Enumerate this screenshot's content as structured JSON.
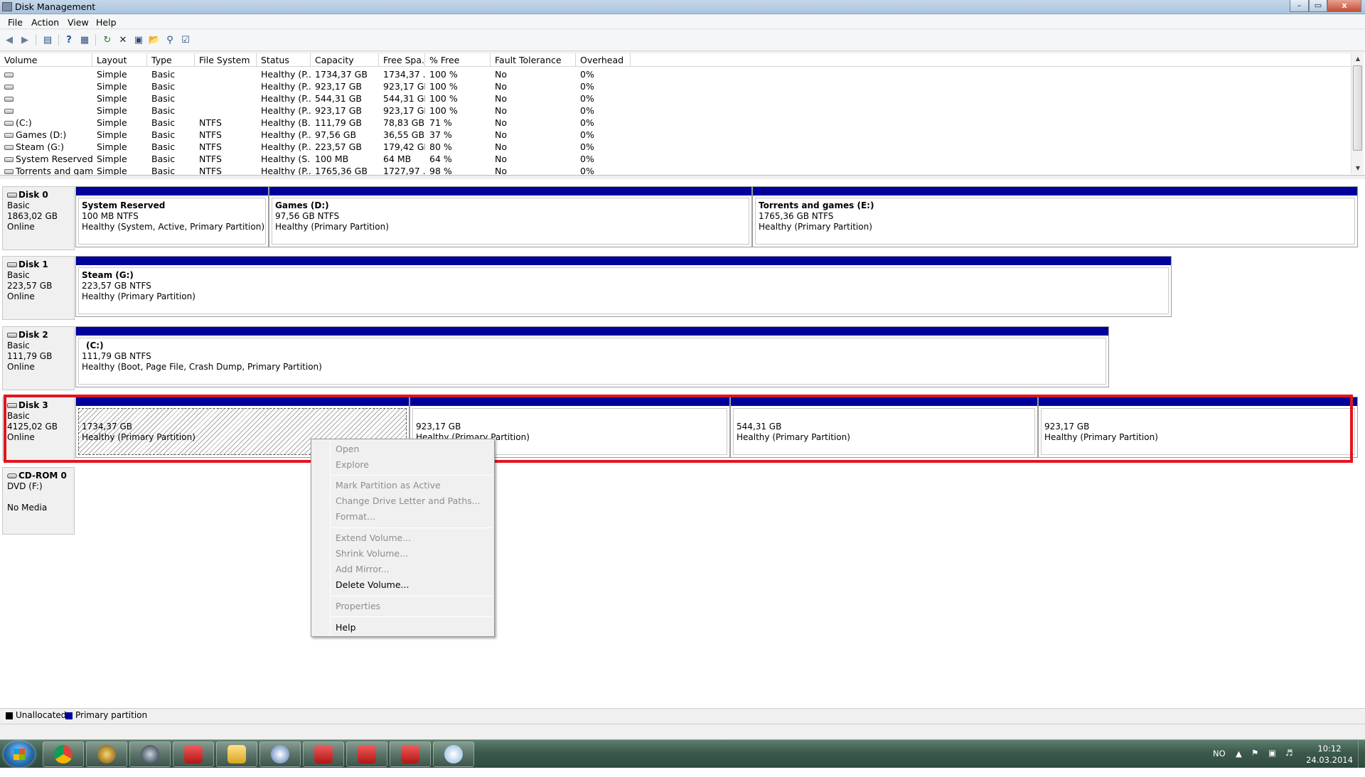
{
  "window": {
    "title": "Disk Management",
    "min_glyph": "–",
    "max_glyph": "▭",
    "close_glyph": "x"
  },
  "menu": [
    "File",
    "Action",
    "View",
    "Help"
  ],
  "toolbar": {
    "icons": [
      "back-arrow-icon",
      "forward-arrow-icon",
      "show-hide-console-tree-icon",
      "help-icon",
      "properties-grid-icon",
      "refresh-icon",
      "delete-icon",
      "properties-icon",
      "open-icon",
      "explore-icon",
      "rescan-icon"
    ]
  },
  "volume_table": {
    "columns": [
      "Volume",
      "Layout",
      "Type",
      "File System",
      "Status",
      "Capacity",
      "Free Spa...",
      "% Free",
      "Fault Tolerance",
      "Overhead"
    ],
    "rows": [
      [
        "",
        "Simple",
        "Basic",
        "",
        "Healthy (P...",
        "1734,37 GB",
        "1734,37 ...",
        "100 %",
        "No",
        "0%"
      ],
      [
        "",
        "Simple",
        "Basic",
        "",
        "Healthy (P...",
        "923,17 GB",
        "923,17 GB",
        "100 %",
        "No",
        "0%"
      ],
      [
        "",
        "Simple",
        "Basic",
        "",
        "Healthy (P...",
        "544,31 GB",
        "544,31 GB",
        "100 %",
        "No",
        "0%"
      ],
      [
        "",
        "Simple",
        "Basic",
        "",
        "Healthy (P...",
        "923,17 GB",
        "923,17 GB",
        "100 %",
        "No",
        "0%"
      ],
      [
        "(C:)",
        "Simple",
        "Basic",
        "NTFS",
        "Healthy (B...",
        "111,79 GB",
        "78,83 GB",
        "71 %",
        "No",
        "0%"
      ],
      [
        "Games (D:)",
        "Simple",
        "Basic",
        "NTFS",
        "Healthy (P...",
        "97,56 GB",
        "36,55 GB",
        "37 %",
        "No",
        "0%"
      ],
      [
        "Steam (G:)",
        "Simple",
        "Basic",
        "NTFS",
        "Healthy (P...",
        "223,57 GB",
        "179,42 GB",
        "80 %",
        "No",
        "0%"
      ],
      [
        "System Reserved",
        "Simple",
        "Basic",
        "NTFS",
        "Healthy (S...",
        "100 MB",
        "64 MB",
        "64 %",
        "No",
        "0%"
      ],
      [
        "Torrents and gam...",
        "Simple",
        "Basic",
        "NTFS",
        "Healthy (P...",
        "1765,36 GB",
        "1727,97 ...",
        "98 %",
        "No",
        "0%"
      ]
    ]
  },
  "disks": [
    {
      "name": "Disk 0",
      "type": "Basic",
      "size": "1863,02 GB",
      "status": "Online",
      "partitions": [
        {
          "title": "System Reserved",
          "size": "100 MB NTFS",
          "status": "Healthy (System, Active, Primary Partition)"
        },
        {
          "title": "Games  (D:)",
          "size": "97,56 GB NTFS",
          "status": "Healthy (Primary Partition)"
        },
        {
          "title": "Torrents and games  (E:)",
          "size": "1765,36 GB NTFS",
          "status": "Healthy (Primary Partition)"
        }
      ]
    },
    {
      "name": "Disk 1",
      "type": "Basic",
      "size": "223,57 GB",
      "status": "Online",
      "partitions": [
        {
          "title": "Steam  (G:)",
          "size": "223,57 GB NTFS",
          "status": "Healthy (Primary Partition)"
        }
      ]
    },
    {
      "name": "Disk 2",
      "type": "Basic",
      "size": "111,79 GB",
      "status": "Online",
      "partitions": [
        {
          "title": "(C:)",
          "size": "111,79 GB NTFS",
          "status": "Healthy (Boot, Page File, Crash Dump, Primary Partition)"
        }
      ]
    },
    {
      "name": "Disk 3",
      "type": "Basic",
      "size": "4125,02 GB",
      "status": "Online",
      "partitions": [
        {
          "title": "",
          "size": "1734,37 GB",
          "status": "Healthy (Primary Partition)"
        },
        {
          "title": "",
          "size": "923,17 GB",
          "status": "Healthy (Primary Partition)"
        },
        {
          "title": "",
          "size": "544,31 GB",
          "status": "Healthy (Primary Partition)"
        },
        {
          "title": "",
          "size": "923,17 GB",
          "status": "Healthy (Primary Partition)"
        }
      ]
    },
    {
      "name": "CD-ROM 0",
      "type": "DVD (F:)",
      "size": "",
      "status": "No Media",
      "partitions": []
    }
  ],
  "legend": {
    "unallocated": "Unallocated",
    "primary": "Primary partition",
    "unallocated_color": "#000000",
    "primary_color": "#00009c"
  },
  "context_menu": {
    "items": [
      {
        "label": "Open",
        "enabled": false
      },
      {
        "label": "Explore",
        "enabled": false
      },
      {
        "label": "Mark Partition as Active",
        "enabled": false
      },
      {
        "label": "Change Drive Letter and Paths...",
        "enabled": false
      },
      {
        "label": "Format...",
        "enabled": false
      },
      {
        "label": "Extend Volume...",
        "enabled": false
      },
      {
        "label": "Shrink Volume...",
        "enabled": false
      },
      {
        "label": "Add Mirror...",
        "enabled": false
      },
      {
        "label": "Delete Volume...",
        "enabled": true
      },
      {
        "label": "Properties",
        "enabled": false
      },
      {
        "label": "Help",
        "enabled": true
      }
    ]
  },
  "taskbar": {
    "apps": [
      "chrome-icon",
      "warcraft-icon",
      "steam-icon",
      "toolbox-icon",
      "explorer-folder-icon",
      "network-tool-icon",
      "toolbox-icon",
      "toolbox-icon",
      "toolbox-icon",
      "paint-icon"
    ],
    "language": "NO",
    "time": "10:12",
    "date": "24.03.2014"
  },
  "colors": {
    "primary_band": "#00009c",
    "selection_frame": "#e3151d"
  }
}
